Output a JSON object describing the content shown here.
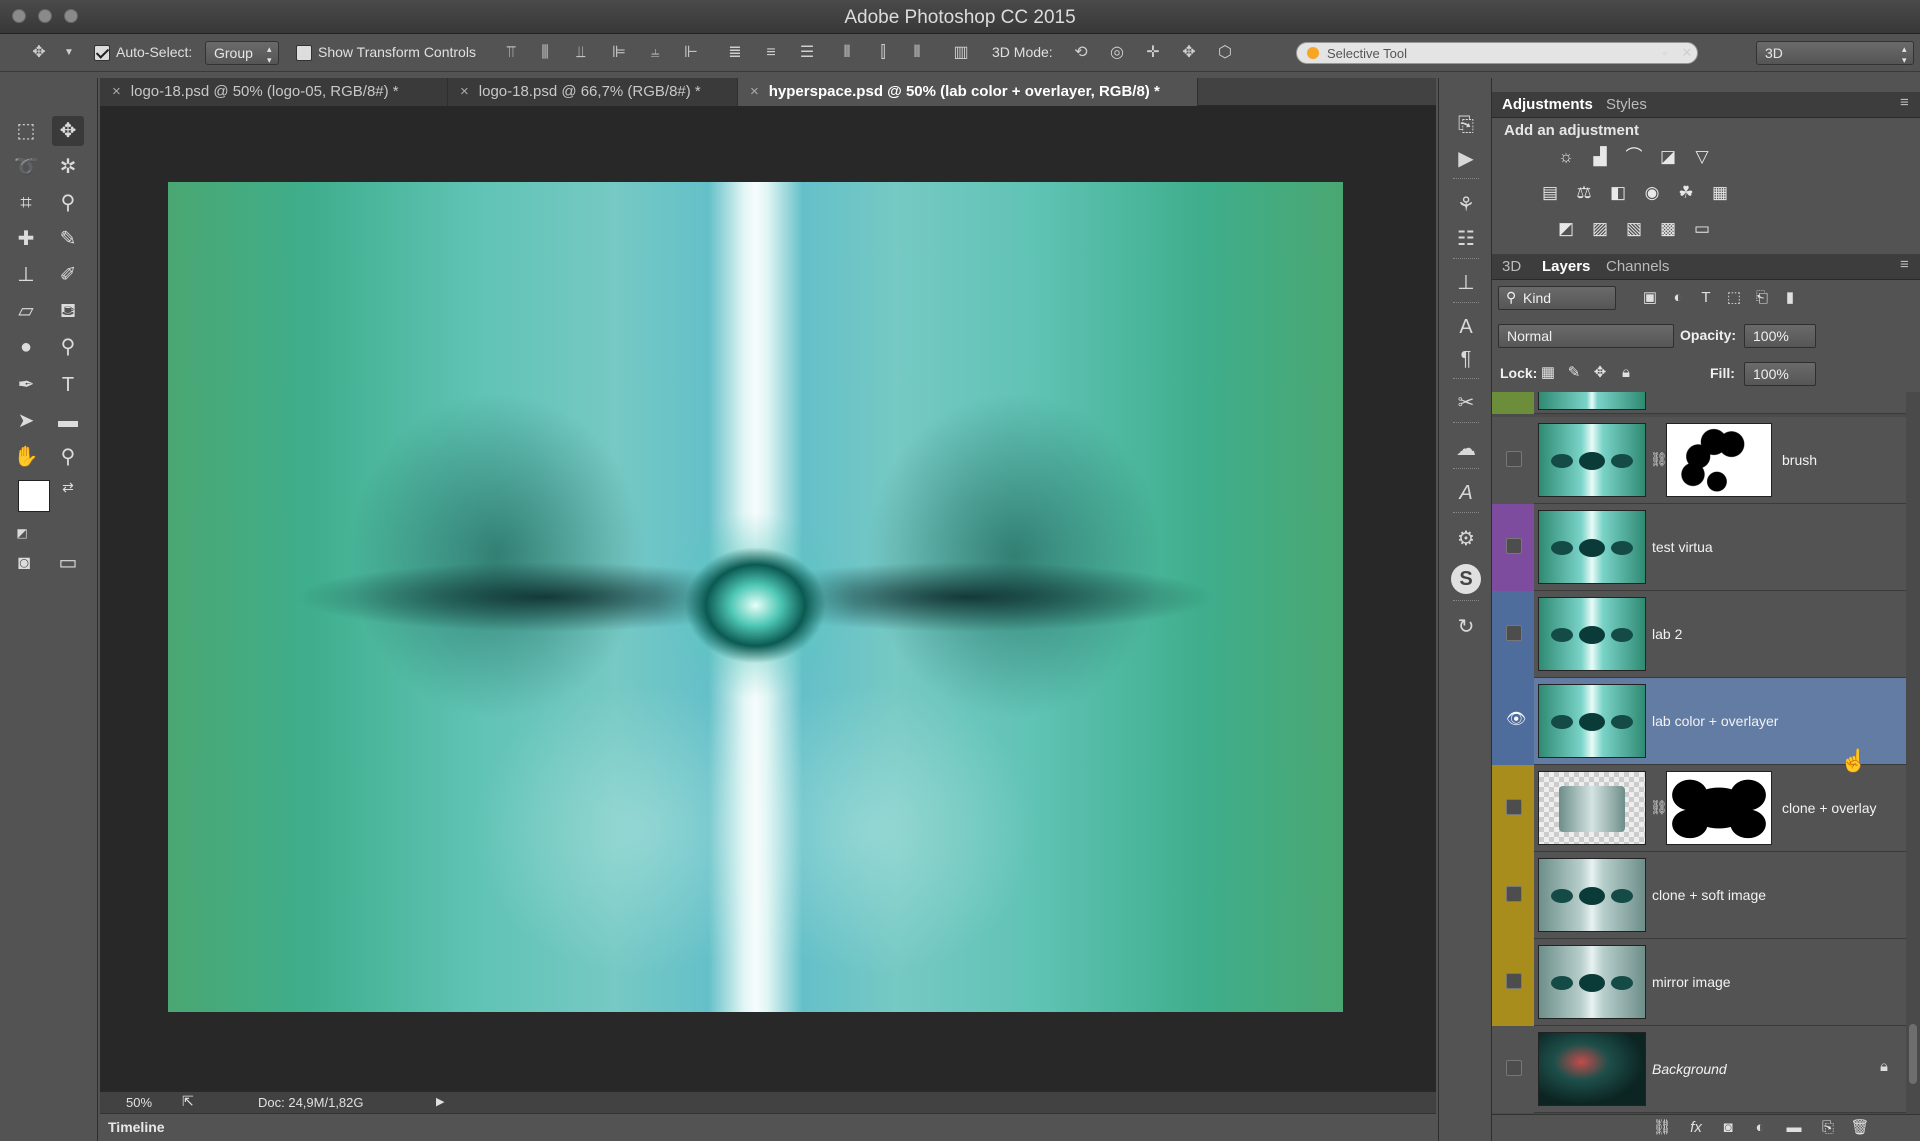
{
  "app": {
    "title": "Adobe Photoshop CC 2015"
  },
  "options_bar": {
    "auto_select_label": "Auto-Select:",
    "auto_select_value": "Group",
    "show_transform_label": "Show Transform Controls",
    "three_d_mode_label": "3D Mode:",
    "search_placeholder": "Selective Tool",
    "workspace_value": "3D"
  },
  "tabs": [
    {
      "label": "logo-18.psd @ 50% (logo-05, RGB/8#) *"
    },
    {
      "label": "logo-18.psd @ 66,7% (RGB/8#) *"
    },
    {
      "label": "hyperspace.psd @ 50% (lab color + overlayer, RGB/8) *"
    }
  ],
  "status": {
    "zoom": "50%",
    "doc": "Doc: 24,9M/1,82G"
  },
  "timeline": {
    "label": "Timeline"
  },
  "adjust_panel": {
    "tabs": [
      "Adjustments",
      "Styles"
    ],
    "title": "Add an adjustment"
  },
  "layers_panel": {
    "tabs": [
      "3D",
      "Layers",
      "Channels"
    ],
    "filter_value": "Kind",
    "blend_mode": "Normal",
    "opacity_label": "Opacity:",
    "opacity_value": "100%",
    "lock_label": "Lock:",
    "fill_label": "Fill:",
    "fill_value": "100%",
    "layers": [
      {
        "name": "brush",
        "color": "#535353",
        "visible": false,
        "mask": "brush"
      },
      {
        "name": "test virtua",
        "color": "#7d4c9e",
        "visible": false
      },
      {
        "name": "lab 2",
        "color": "#4f6d9c",
        "visible": false
      },
      {
        "name": "lab color + overlayer",
        "color": "#4f6d9c",
        "visible": true,
        "selected": true
      },
      {
        "name": "clone + overlay",
        "color": "#a98d1c",
        "visible": false,
        "mask": "blob"
      },
      {
        "name": "clone + soft image",
        "color": "#a98d1c",
        "visible": false
      },
      {
        "name": "mirror image",
        "color": "#a98d1c",
        "visible": false
      },
      {
        "name": "Background",
        "color": "#535353",
        "visible": false,
        "locked": true
      }
    ]
  },
  "colors": {
    "accent_selected": "#627ca4",
    "green_layer": "#6c8d3a"
  }
}
